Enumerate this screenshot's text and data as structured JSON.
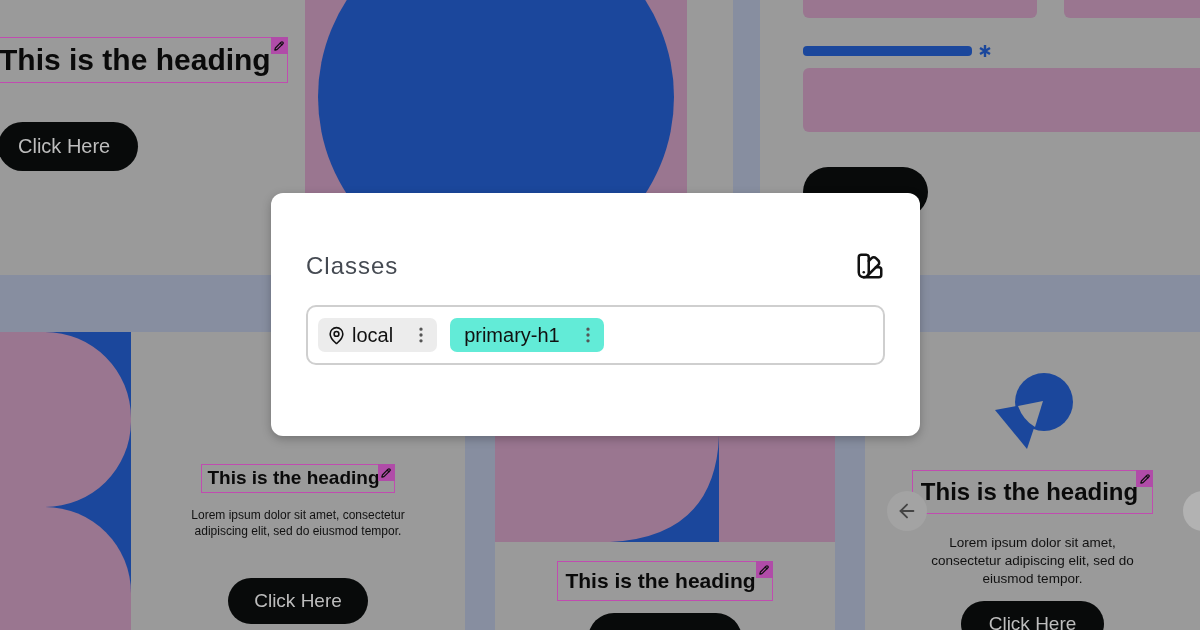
{
  "canvas": {
    "frames": [
      {
        "kind": "hero",
        "heading": "This is the heading",
        "button": "Click Here"
      },
      {
        "kind": "circle-art"
      },
      {
        "kind": "form"
      },
      {
        "kind": "split",
        "heading": "This is the heading",
        "body": "Lorem ipsum dolor sit amet, consectetur adipiscing elit, sed do eiusmod tempor.",
        "button": "Click Here"
      },
      {
        "kind": "art-card",
        "heading": "This is the heading"
      },
      {
        "kind": "carousel",
        "heading": "This is the heading",
        "body": "Lorem ipsum dolor sit amet, consectetur adipiscing elit, sed do eiusmod tempor.",
        "button": "Click Here"
      }
    ]
  },
  "classes_panel": {
    "title": "Classes",
    "chips": [
      {
        "kind": "local",
        "label": "local"
      },
      {
        "kind": "class",
        "label": "primary-h1"
      }
    ]
  }
}
